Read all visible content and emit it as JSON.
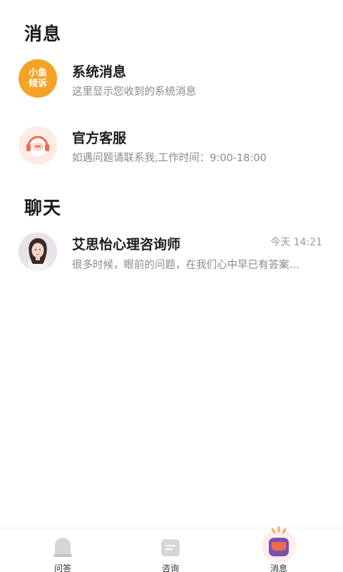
{
  "sections": {
    "messages_title": "消息",
    "chat_title": "聊天"
  },
  "system_message": {
    "logo_line1": "小鱼",
    "logo_line2": "倾诉",
    "title": "系统消息",
    "subtitle": "这里显示您收到的系统消息"
  },
  "customer_service": {
    "title": "官方客服",
    "subtitle": "如遇问题请联系我,工作时间：9:00-18:00"
  },
  "chats": [
    {
      "name": "艾思怡心理咨询师",
      "time": "今天 14:21",
      "preview": "很多时候，眼前的问题，在我们心中早已有答案…"
    }
  ],
  "tabbar": {
    "tabs": [
      {
        "label": "问答",
        "icon": "qa-icon"
      },
      {
        "label": "咨询",
        "icon": "consult-icon"
      },
      {
        "label": "消息",
        "icon": "message-icon",
        "active": true
      }
    ]
  },
  "colors": {
    "system_logo": "#f3a326",
    "service_accent": "#f26b4f",
    "message_tab_purple": "#7b4fb0"
  }
}
